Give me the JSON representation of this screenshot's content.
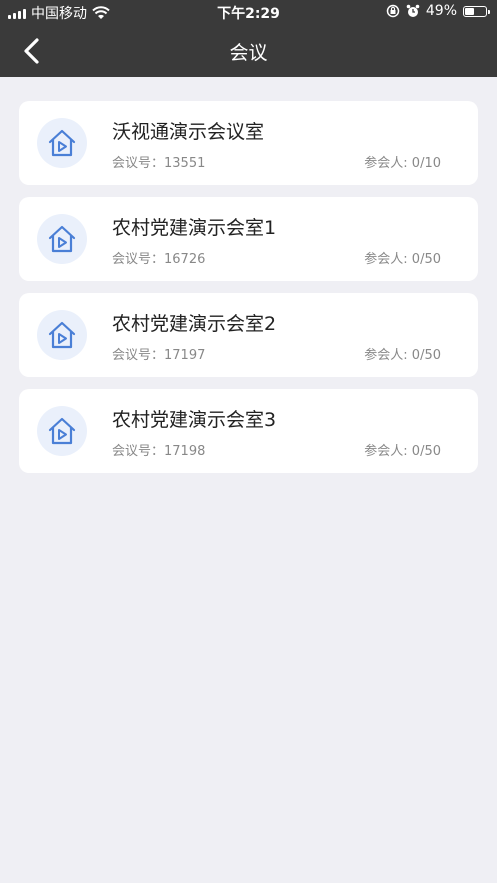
{
  "statusbar": {
    "carrier": "中国移动",
    "time": "下午2:29",
    "battery": "49%",
    "battery_level": 0.49
  },
  "header": {
    "title": "会议"
  },
  "rooms": [
    {
      "name": "沃视通演示会议室",
      "id_label": "会议号：13551",
      "participants": "参会人: 0/10"
    },
    {
      "name": "农村党建演示会室1",
      "id_label": "会议号：16726",
      "participants": "参会人: 0/50"
    },
    {
      "name": "农村党建演示会室2",
      "id_label": "会议号：17197",
      "participants": "参会人: 0/50"
    },
    {
      "name": "农村党建演示会室3",
      "id_label": "会议号：17198",
      "participants": "参会人: 0/50"
    }
  ],
  "colors": {
    "header_bg": "#3a3a3a",
    "icon_accent": "#4a7fd6",
    "page_bg": "#efeff4"
  },
  "icons": {
    "room": "home-play-icon",
    "back": "chevron-left-icon"
  }
}
